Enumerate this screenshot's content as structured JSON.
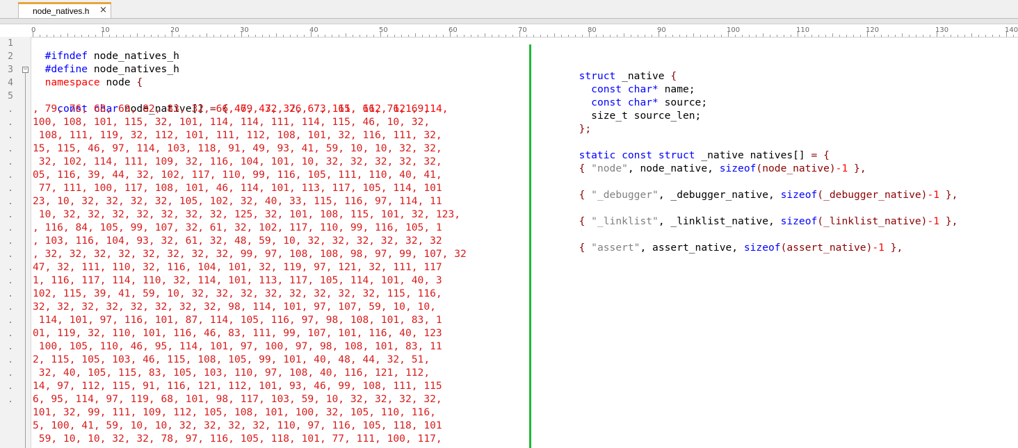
{
  "tab": {
    "title": "node_natives.h",
    "close": "×"
  },
  "ruler": {
    "labels": [
      "0",
      "10",
      "20",
      "30",
      "40",
      "50",
      "60",
      "70",
      "80",
      "90",
      "100",
      "110",
      "120",
      "130",
      "140"
    ]
  },
  "gutter": {
    "numbers": [
      "1",
      "2",
      "3",
      "4",
      "5",
      ".",
      ".",
      ".",
      ".",
      ".",
      ".",
      ".",
      ".",
      ".",
      ".",
      ".",
      ".",
      ".",
      ".",
      ".",
      ".",
      ".",
      ".",
      ".",
      ".",
      ".",
      ".",
      "."
    ]
  },
  "code": {
    "line1": {
      "directive": "#ifndef",
      "name": "node_natives_h"
    },
    "line2": {
      "directive": "#define",
      "name": "node_natives_h"
    },
    "line3": {
      "kw": "namespace",
      "name": "node",
      "brace": "{"
    },
    "line5": {
      "kw1": "const",
      "kw2": "char",
      "name": "node_native[]",
      "op": "= {",
      "nums": "47, 47, 32, 67, 111, 112, 121, 114,"
    },
    "data": [
      ", 79, 76, 68, 69, 82, 83, 32, 66, 69, 32, 76, 73, 65, 66, 76, 69,",
      "100, 108, 101, 115, 32, 101, 114, 114, 111, 114, 115, 46, 10, 32,",
      " 108, 111, 119, 32, 112, 101, 111, 112, 108, 101, 32, 116, 111, 32,",
      "15, 115, 46, 97, 114, 103, 118, 91, 49, 93, 41, 59, 10, 10, 32, 32,",
      " 32, 102, 114, 111, 109, 32, 116, 104, 101, 10, 32, 32, 32, 32, 32,",
      "05, 116, 39, 44, 32, 102, 117, 110, 99, 116, 105, 111, 110, 40, 41,",
      " 77, 111, 100, 117, 108, 101, 46, 114, 101, 113, 117, 105, 114, 101",
      "23, 10, 32, 32, 32, 32, 105, 102, 32, 40, 33, 115, 116, 97, 114, 11",
      " 10, 32, 32, 32, 32, 32, 32, 32, 125, 32, 101, 108, 115, 101, 32, 123,",
      ", 116, 84, 105, 99, 107, 32, 61, 32, 102, 117, 110, 99, 116, 105, 1",
      ", 103, 116, 104, 93, 32, 61, 32, 48, 59, 10, 32, 32, 32, 32, 32, 32",
      ", 32, 32, 32, 32, 32, 32, 32, 32, 99, 97, 108, 108, 98, 97, 99, 107, 32",
      "47, 32, 111, 110, 32, 116, 104, 101, 32, 119, 97, 121, 32, 111, 117",
      "1, 116, 117, 114, 110, 32, 114, 101, 113, 117, 105, 114, 101, 40, 3",
      "102, 115, 39, 41, 59, 10, 32, 32, 32, 32, 32, 32, 32, 32, 115, 116,",
      "32, 32, 32, 32, 32, 32, 32, 32, 98, 114, 101, 97, 107, 59, 10, 10,",
      " 114, 101, 97, 116, 101, 87, 114, 105, 116, 97, 98, 108, 101, 83, 1",
      "01, 119, 32, 110, 101, 116, 46, 83, 111, 99, 107, 101, 116, 40, 123",
      " 100, 105, 110, 46, 95, 114, 101, 97, 100, 97, 98, 108, 101, 83, 11",
      "2, 115, 105, 103, 46, 115, 108, 105, 99, 101, 40, 48, 44, 32, 51,",
      " 32, 40, 105, 115, 83, 105, 103, 110, 97, 108, 40, 116, 121, 112,",
      "14, 97, 112, 115, 91, 116, 121, 112, 101, 93, 46, 99, 108, 111, 115",
      "6, 95, 114, 97, 119, 68, 101, 98, 117, 103, 59, 10, 32, 32, 32, 32,",
      "101, 32, 99, 111, 109, 112, 105, 108, 101, 100, 32, 105, 110, 116,",
      "5, 100, 41, 59, 10, 10, 32, 32, 32, 32, 110, 97, 116, 105, 118, 101",
      " 59, 10, 10, 32, 32, 78, 97, 116, 105, 118, 101, 77, 111, 100, 117,"
    ],
    "right": {
      "struct_kw": "struct",
      "struct_name": "_native",
      "open": "{",
      "m1_kw1": "const",
      "m1_kw2": "char*",
      "m1_name": "name;",
      "m2_kw1": "const",
      "m2_kw2": "char*",
      "m2_name": "source;",
      "m3_name": "size_t source_len;",
      "close": "};",
      "decl_kw1": "static",
      "decl_kw2": "const",
      "decl_kw3": "struct",
      "decl_name": "_native natives[]",
      "decl_op": "= {",
      "entries": [
        {
          "open": "{",
          "str": "\"node\"",
          "name": "node_native,",
          "sizeof": "sizeof",
          "arg": "(node_native)",
          "minus": "-1",
          "close": "},"
        },
        {
          "open": "{",
          "str": "\"_debugger\"",
          "name": "_debugger_native,",
          "sizeof": "sizeof",
          "arg": "(_debugger_native)",
          "minus": "-1",
          "close": "},"
        },
        {
          "open": "{",
          "str": "\"_linklist\"",
          "name": "_linklist_native,",
          "sizeof": "sizeof",
          "arg": "(_linklist_native)",
          "minus": "-1",
          "close": "},"
        },
        {
          "open": "{",
          "str": "\"assert\"",
          "name": "assert_native,",
          "sizeof": "sizeof",
          "arg": "(assert_native)",
          "minus": "-1",
          "close": "},"
        }
      ]
    }
  },
  "colors": {
    "divider": "#1fb83a",
    "tab_accent": "#e9a33b",
    "data": "#d81b1b",
    "keyword_blue": "#0000ff"
  }
}
